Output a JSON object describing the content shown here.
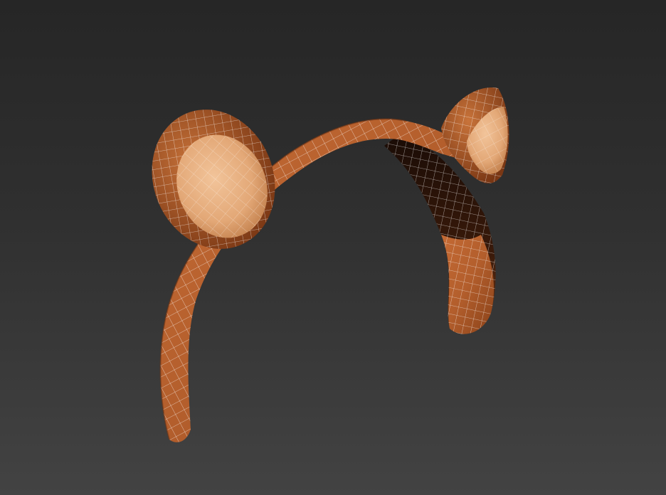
{
  "viewport": {
    "background_top": "#262626",
    "background_bottom": "#434343"
  },
  "model": {
    "subject": "headband-with-bear-ears",
    "shading": "smooth-with-wireframe-overlay",
    "colors": {
      "band": "#b8622f",
      "band_shadow": "#6e3212",
      "inner_ear": "#e8b488",
      "wire": "#ffffff"
    }
  }
}
